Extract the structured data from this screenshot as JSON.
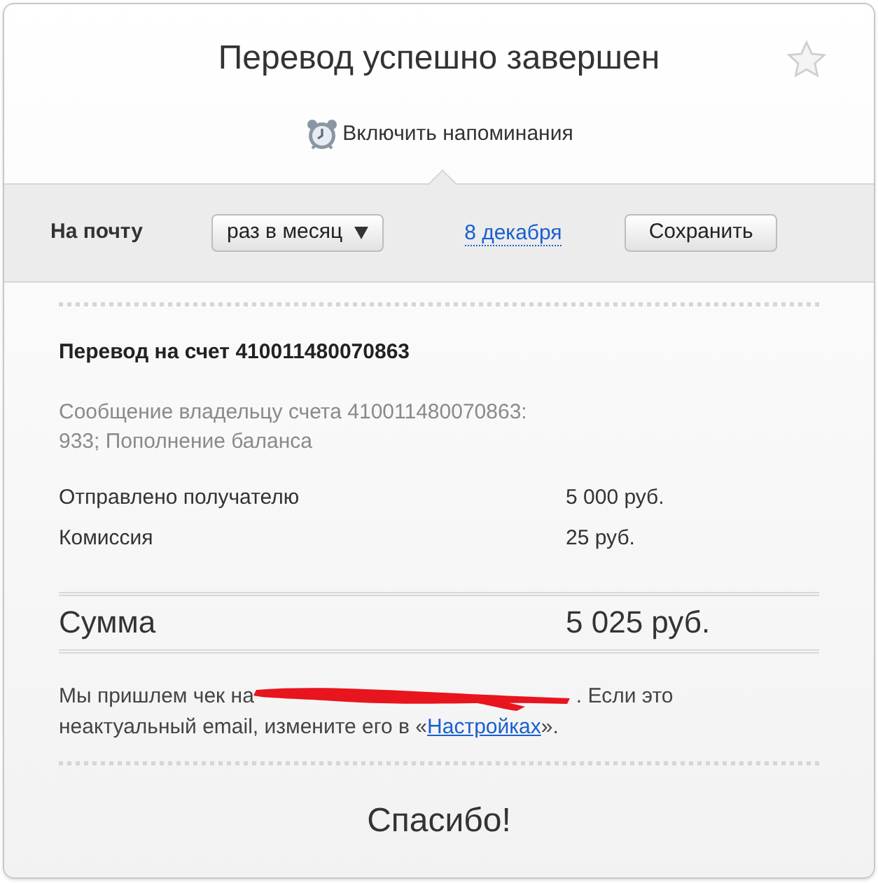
{
  "title": "Перевод успешно завершен",
  "favorite": false,
  "reminder": {
    "label": "Включить напоминания"
  },
  "delivery": {
    "label": "На почту",
    "frequency": "раз в месяц",
    "date": "8 декабря",
    "save_button": "Сохранить"
  },
  "transfer": {
    "title": "Перевод на счет 410011480070863",
    "message": "Сообщение владельцу счета 410011480070863: 933; Пополнение баланса"
  },
  "rows": [
    {
      "label": "Отправлено получателю",
      "value": "5 000 руб."
    },
    {
      "label": "Комиссия",
      "value": "25 руб."
    }
  ],
  "total": {
    "label": "Сумма",
    "value": "5 025 руб."
  },
  "receipt": {
    "before": "Мы пришлем чек на",
    "after": ". Если это неактуальный email, измените его в «",
    "link": "Настройках",
    "end": "»."
  },
  "thanks": "Спасибо!"
}
